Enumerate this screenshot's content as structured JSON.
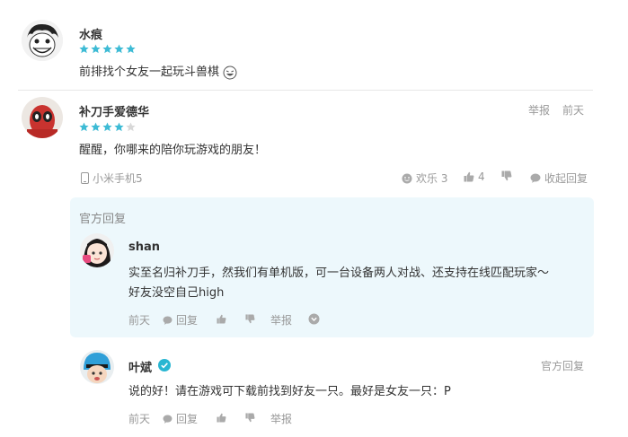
{
  "comments": {
    "c1": {
      "username": "水痕",
      "stars": 5,
      "text": "前排找个女友一起玩斗兽棋"
    },
    "c2": {
      "username": "补刀手爱德华",
      "stars": 4,
      "text": "醒醒，你哪来的陪你玩游戏的朋友！",
      "report": "举报",
      "time": "前天",
      "device": "小米手机5",
      "emotion": "欢乐 3",
      "likes": "4",
      "collapse": "收起回复"
    }
  },
  "replies": {
    "official": {
      "tag": "官方回复",
      "username": "shan",
      "text_line1": "实至名归补刀手，然我们有单机版，可一台设备两人对战、还支持在线匹配玩家～",
      "text_line2": "好友没空自己high",
      "time": "前天",
      "reply": "回复",
      "report": "举报"
    },
    "r2": {
      "username": "叶斌",
      "tag": "官方回复",
      "text": "说的好！请在游戏可下载前找到好友一只。最好是女友一只：P",
      "time": "前天",
      "reply": "回复",
      "report": "举报"
    }
  },
  "colors": {
    "star": "#3dbbd5",
    "verified": "#29b6d2",
    "official_bg": "#edf8fc"
  }
}
